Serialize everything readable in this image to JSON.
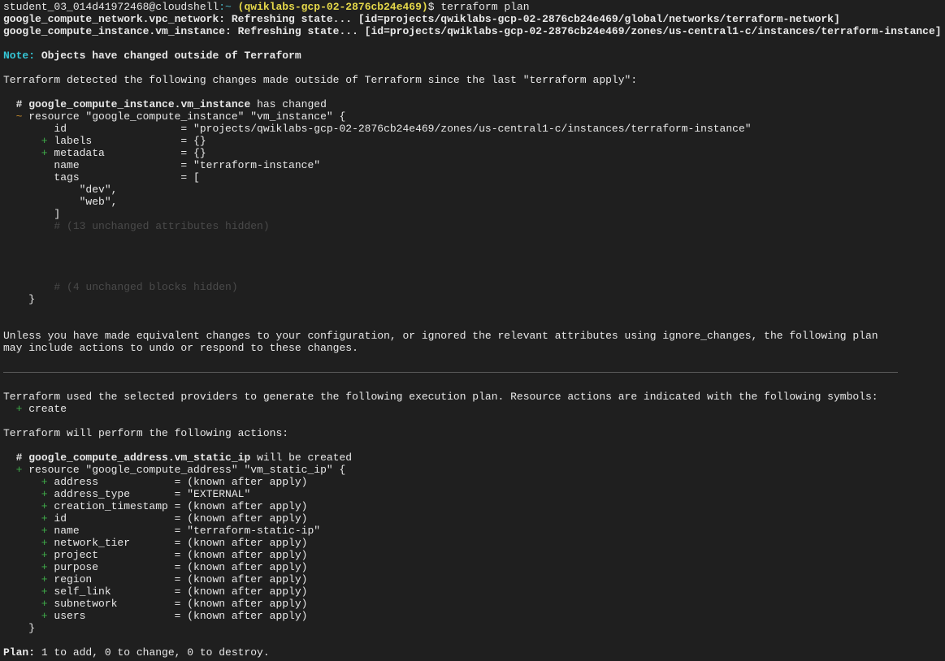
{
  "prompt": {
    "user_host": "student_03_014d41972468@cloudshell",
    "path": ":~",
    "project": "(qwiklabs-gcp-02-2876cb24e469)",
    "command": "$ terraform plan"
  },
  "refresh": [
    "google_compute_network.vpc_network: Refreshing state... [id=projects/qwiklabs-gcp-02-2876cb24e469/global/networks/terraform-network]",
    "google_compute_instance.vm_instance: Refreshing state... [id=projects/qwiklabs-gcp-02-2876cb24e469/zones/us-central1-c/instances/terraform-instance]"
  ],
  "note": {
    "label": "Note:",
    "text": " Objects have changed outside of Terraform"
  },
  "detected": "Terraform detected the following changes made outside of Terraform since the last \"terraform apply\":",
  "changed": {
    "hash": "  # ",
    "resource": "google_compute_instance.vm_instance",
    "suffix": " has changed",
    "tilde": "  ~",
    "header": " resource \"google_compute_instance\" \"vm_instance\" {",
    "attrs": [
      {
        "mark": "",
        "text": "        id                  = \"projects/qwiklabs-gcp-02-2876cb24e469/zones/us-central1-c/instances/terraform-instance\""
      },
      {
        "mark": "      +",
        "text": " labels              = {}"
      },
      {
        "mark": "      +",
        "text": " metadata            = {}"
      },
      {
        "mark": "",
        "text": "        name                = \"terraform-instance\""
      },
      {
        "mark": "",
        "text": "        tags                = ["
      },
      {
        "mark": "",
        "text": "            \"dev\","
      },
      {
        "mark": "",
        "text": "            \"web\","
      },
      {
        "mark": "",
        "text": "        ]"
      }
    ],
    "hidden_attrs": "        # (13 unchanged attributes hidden)",
    "hidden_blocks": "        # (4 unchanged blocks hidden)",
    "close": "    }"
  },
  "unless": [
    "Unless you have made equivalent changes to your configuration, or ignored the relevant attributes using ignore_changes, the following plan",
    "may include actions to undo or respond to these changes."
  ],
  "used": "Terraform used the selected providers to generate the following execution plan. Resource actions are indicated with the following symbols:",
  "symbol": {
    "mark": "  +",
    "text": " create"
  },
  "perform": "Terraform will perform the following actions:",
  "created": {
    "hash": "  # ",
    "resource": "google_compute_address.vm_static_ip",
    "suffix": " will be created",
    "plus": "  +",
    "header": " resource \"google_compute_address\" \"vm_static_ip\" {",
    "attrs": [
      " address            = (known after apply)",
      " address_type       = \"EXTERNAL\"",
      " creation_timestamp = (known after apply)",
      " id                 = (known after apply)",
      " name               = \"terraform-static-ip\"",
      " network_tier       = (known after apply)",
      " project            = (known after apply)",
      " purpose            = (known after apply)",
      " region             = (known after apply)",
      " self_link          = (known after apply)",
      " subnetwork         = (known after apply)",
      " users              = (known after apply)"
    ],
    "attr_mark": "      +",
    "close": "    }"
  },
  "plan": {
    "label": "Plan:",
    "text": " 1 to add, 0 to change, 0 to destroy."
  },
  "colors": {
    "background": "#1f1f1f",
    "text": "#e8e8e8",
    "note": "#35c6d6",
    "project": "#e6d94a",
    "path": "#4bb6c4",
    "add": "#3fae4a",
    "change": "#c4892b",
    "hidden": "#4a4a4a"
  }
}
